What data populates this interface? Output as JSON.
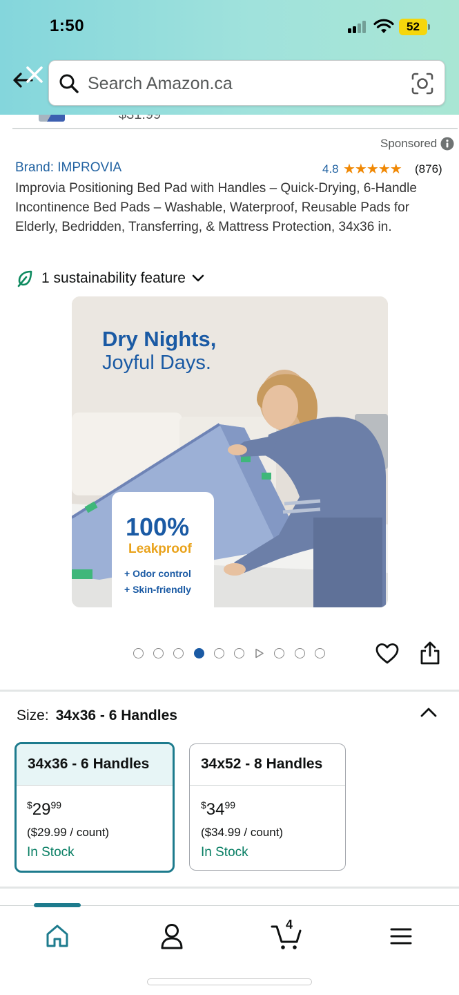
{
  "status_bar": {
    "time": "1:50",
    "battery": "52",
    "signal_icon": "signal-icon",
    "wifi_icon": "wifi-icon"
  },
  "search": {
    "placeholder": "Search Amazon.ca",
    "value": "",
    "back_icon": "back-close-icon",
    "lens_icon": "camera-lens-icon"
  },
  "product": {
    "sponsored": "Sponsored",
    "brand": "Brand: IMPROVIA",
    "rating": "4.8",
    "stars": "★★★★★",
    "rating_count": "(876)",
    "title": "Improvia Positioning Bed Pad with Handles – Quick-Drying, 6-Handle Incontinence Bed Pads – Washable, Waterproof, Reusable Pads for Elderly, Bedridden, Transferring, & Mattress Protection, 34x36 in.",
    "sustainability": "1 sustainability feature"
  },
  "image": {
    "headline_1": "Dry Nights,",
    "headline_2": "Joyful Days.",
    "badge_big": "100%",
    "badge_sub": "Leakproof",
    "feature_1": "+ Odor control",
    "feature_2": "+ Skin-friendly",
    "carousel": {
      "total_slots": 10,
      "active_index": 3,
      "video_index": 6
    }
  },
  "size": {
    "label": "Size:",
    "value": "34x36 - 6 Handles",
    "options": [
      {
        "name": "34x36 - 6 Handles",
        "currency": "$",
        "price_whole": "29",
        "price_fraction": "99",
        "unit_price": "($29.99 / count)",
        "stock": "In Stock",
        "selected": true
      },
      {
        "name": "34x52 - 8 Handles",
        "currency": "$",
        "price_whole": "34",
        "price_fraction": "99",
        "unit_price": "($34.99 / count)",
        "stock": "In Stock",
        "selected": false
      }
    ]
  },
  "bottom_nav": {
    "cart_count": "4",
    "items": [
      "home-icon",
      "account-icon",
      "cart-icon",
      "menu-icon"
    ],
    "active": "home-icon"
  },
  "colors": {
    "header_gradient_start": "#84d6dc",
    "header_gradient_end": "#a9e6d4",
    "link_blue": "#2162a1",
    "star_orange": "#f08804",
    "stock_green": "#067d62",
    "selected_teal": "#1d7b8d",
    "battery_yellow": "#f5d60c"
  }
}
